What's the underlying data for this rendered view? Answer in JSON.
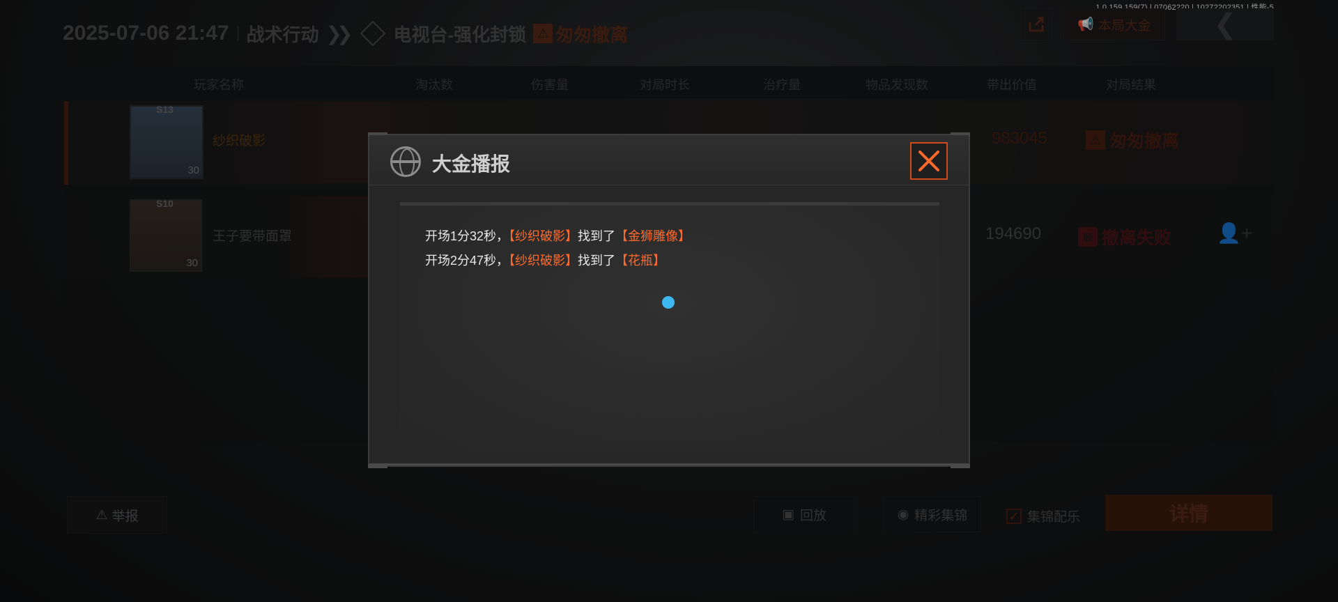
{
  "version": "1.0.159.159(7) | 07062220 | 10272202351 | 性能-5",
  "header": {
    "datetime": "2025-07-06 21:47",
    "mode": "战术行动",
    "arrows": "❯❯",
    "map": "电视台-强化封锁",
    "status": "匆匆撤离"
  },
  "top_buttons": {
    "gold_label": "本局大金"
  },
  "table": {
    "columns": [
      "玩家名称",
      "淘汰数",
      "伤害量",
      "对局时长",
      "治疗量",
      "物品发现数",
      "带出价值",
      "对局结果"
    ],
    "rows": [
      {
        "name": "纱织破影",
        "avatar_badge": "S13",
        "level": "30",
        "value": "983045",
        "result": "匆匆撤离"
      },
      {
        "name": "王子要带面罩",
        "avatar_badge": "S10",
        "level": "30",
        "value": "194690",
        "result": "撤离失败"
      }
    ]
  },
  "bottom": {
    "report": "举报",
    "replay": "回放",
    "highlights": "精彩集锦",
    "music": "集锦配乐",
    "details": "详情"
  },
  "modal": {
    "title": "大金播报",
    "messages": [
      {
        "prefix": "开场1分32秒，",
        "player": "【纱织破影】",
        "mid": "找到了",
        "item": "【金狮雕像】"
      },
      {
        "prefix": "开场2分47秒，",
        "player": "【纱织破影】",
        "mid": "找到了",
        "item": "【花瓶】"
      }
    ]
  },
  "colors": {
    "accent_orange": "#ff6a2c",
    "close_border": "#d24a1c",
    "dot_blue": "#3db8f0"
  }
}
